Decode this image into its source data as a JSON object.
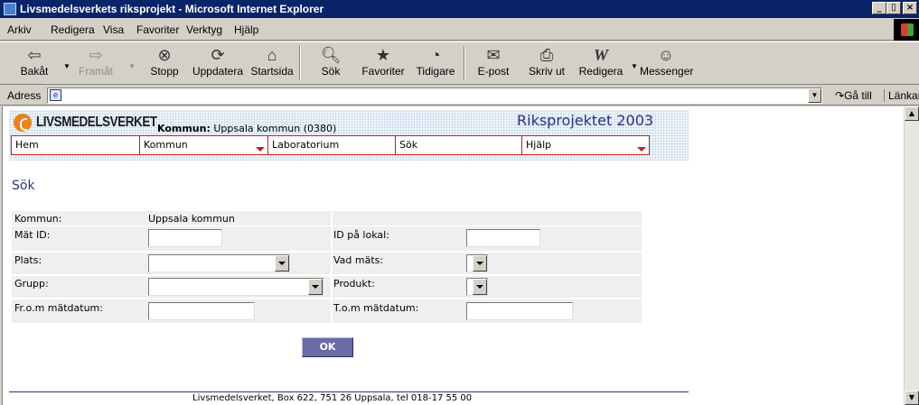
{
  "window": {
    "title": "Livsmedelsverkets riksprojekt - Microsoft Internet Explorer",
    "controls": [
      "_",
      "▯",
      "×"
    ]
  },
  "menu": [
    "Arkiv",
    "Redigera",
    "Visa",
    "Favoriter",
    "Verktyg",
    "Hjälp"
  ],
  "toolbar": {
    "back": "Bakåt",
    "forward": "Framåt",
    "stop": "Stopp",
    "refresh": "Uppdatera",
    "home": "Startsida",
    "search": "Sök",
    "favorites": "Favoriter",
    "history": "Tidigare",
    "mail": "E-post",
    "print": "Skriv ut",
    "edit": "Redigera",
    "messenger": "Messenger"
  },
  "address": {
    "label": "Adress",
    "value": "",
    "go": "Gå till",
    "links": "Länkar"
  },
  "header": {
    "logo_text": "LIVSMEDELSVERKET",
    "kommun_label": "Kommun:",
    "kommun_value": "Uppsala kommun (0380)",
    "project_title": "Riksprojektet 2003"
  },
  "nav": [
    {
      "label": "Hem",
      "has_dropdown": false
    },
    {
      "label": "Kommun",
      "has_dropdown": true
    },
    {
      "label": "Laboratorium",
      "has_dropdown": false
    },
    {
      "label": "Sök",
      "has_dropdown": false
    },
    {
      "label": "Hjälp",
      "has_dropdown": true
    }
  ],
  "page": {
    "title": "Sök"
  },
  "form": {
    "kommun_label": "Kommun:",
    "kommun_value": "Uppsala kommun",
    "mat_id_label": "Mät ID:",
    "mat_id_value": "",
    "id_lokal_label": "ID på lokal:",
    "id_lokal_value": "",
    "plats_label": "Plats:",
    "plats_value": "",
    "vad_mats_label": "Vad mäts:",
    "vad_mats_value": "",
    "grupp_label": "Grupp:",
    "grupp_value": "",
    "produkt_label": "Produkt:",
    "produkt_value": "",
    "from_label": "Fr.o.m mätdatum:",
    "from_value": "",
    "tom_label": "T.o.m mätdatum:",
    "tom_value": "",
    "ok_label": "OK"
  },
  "footer": {
    "text": "Livsmedelsverket, Box 622, 751 26 Uppsala, tel 018-17 55 00"
  },
  "colors": {
    "titlebar": "#0a246a",
    "brand_blue": "#2b2f86",
    "nav_red": "#c41f1f",
    "logo_orange": "#f0801a",
    "button": "#6b6ba8"
  }
}
